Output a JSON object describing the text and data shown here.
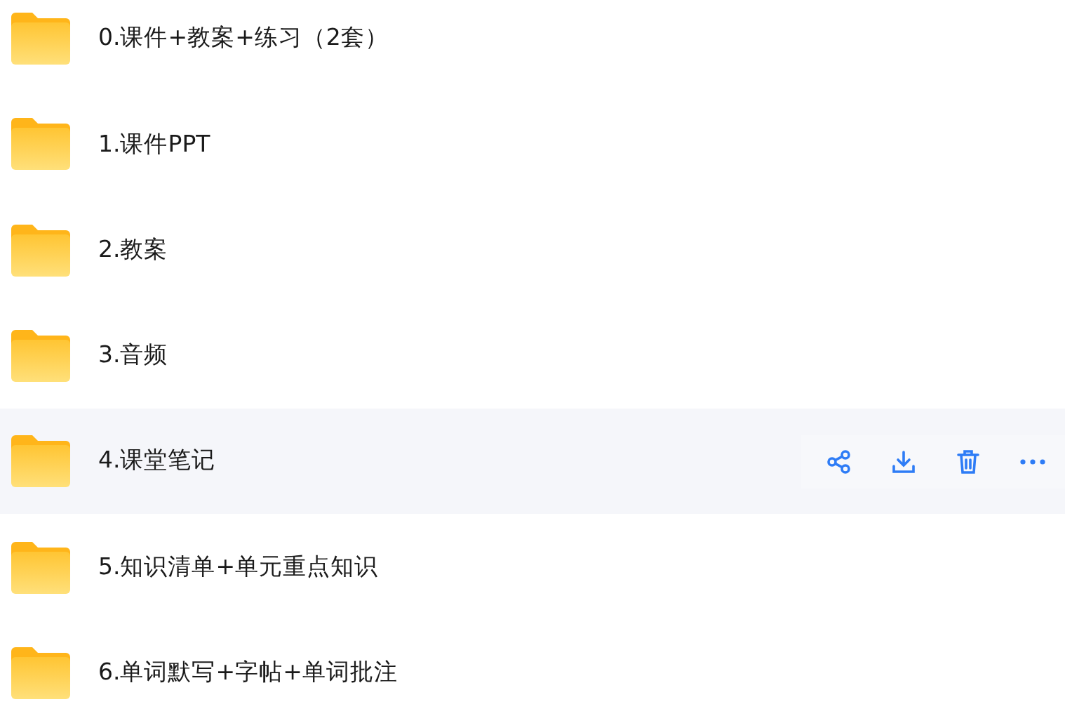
{
  "folders": [
    {
      "name": "0.课件+教案+练习（2套）",
      "hovered": false
    },
    {
      "name": "1.课件PPT",
      "hovered": false
    },
    {
      "name": "2.教案",
      "hovered": false
    },
    {
      "name": "3.音频",
      "hovered": false
    },
    {
      "name": "4.课堂笔记",
      "hovered": true
    },
    {
      "name": "5.知识清单+单元重点知识",
      "hovered": false
    },
    {
      "name": "6.单词默写+字帖+单词批注",
      "hovered": false
    }
  ]
}
